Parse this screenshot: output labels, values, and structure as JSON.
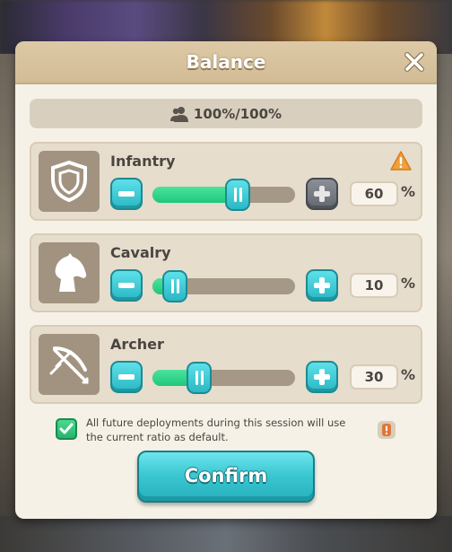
{
  "dialog": {
    "title": "Balance",
    "total_ratio": "100%/100%",
    "units": [
      {
        "name": "Infantry",
        "value": 60,
        "value_text": "60",
        "percent_sign": "%",
        "warning": true,
        "plus_enabled": false,
        "icon": "shield-icon"
      },
      {
        "name": "Cavalry",
        "value": 10,
        "value_text": "10",
        "percent_sign": "%",
        "warning": false,
        "plus_enabled": true,
        "icon": "horse-icon"
      },
      {
        "name": "Archer",
        "value": 30,
        "value_text": "30",
        "percent_sign": "%",
        "warning": false,
        "plus_enabled": true,
        "icon": "crossbow-icon"
      }
    ],
    "default_note": "All future deployments during this session will use the current ratio as default.",
    "default_checked": true,
    "confirm_label": "Confirm"
  },
  "colors": {
    "accent_teal": "#2ab8c4",
    "slider_fill": "#1fc77d",
    "warning": "#f0a03a",
    "panel": "#f6f1e7"
  }
}
